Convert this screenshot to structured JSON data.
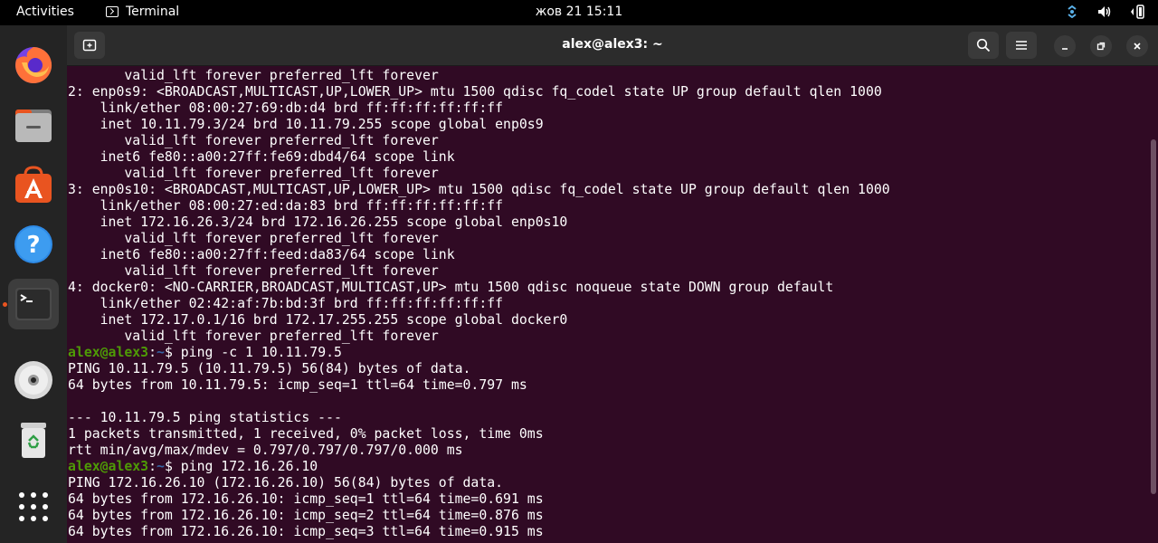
{
  "topbar": {
    "activities": "Activities",
    "app_name": "Terminal",
    "clock": "жов 21  15:11"
  },
  "window": {
    "title": "alex@alex3: ~"
  },
  "dock": {
    "items": [
      "firefox-icon",
      "files-icon",
      "software-icon",
      "help-icon",
      "terminal-icon",
      "dvd-icon",
      "trash-icon",
      "apps-grid-icon"
    ]
  },
  "terminal": {
    "lines": [
      {
        "type": "out",
        "text": "       valid_lft forever preferred_lft forever"
      },
      {
        "type": "out",
        "text": "2: enp0s9: <BROADCAST,MULTICAST,UP,LOWER_UP> mtu 1500 qdisc fq_codel state UP group default qlen 1000"
      },
      {
        "type": "out",
        "text": "    link/ether 08:00:27:69:db:d4 brd ff:ff:ff:ff:ff:ff"
      },
      {
        "type": "out",
        "text": "    inet 10.11.79.3/24 brd 10.11.79.255 scope global enp0s9"
      },
      {
        "type": "out",
        "text": "       valid_lft forever preferred_lft forever"
      },
      {
        "type": "out",
        "text": "    inet6 fe80::a00:27ff:fe69:dbd4/64 scope link"
      },
      {
        "type": "out",
        "text": "       valid_lft forever preferred_lft forever"
      },
      {
        "type": "out",
        "text": "3: enp0s10: <BROADCAST,MULTICAST,UP,LOWER_UP> mtu 1500 qdisc fq_codel state UP group default qlen 1000"
      },
      {
        "type": "out",
        "text": "    link/ether 08:00:27:ed:da:83 brd ff:ff:ff:ff:ff:ff"
      },
      {
        "type": "out",
        "text": "    inet 172.16.26.3/24 brd 172.16.26.255 scope global enp0s10"
      },
      {
        "type": "out",
        "text": "       valid_lft forever preferred_lft forever"
      },
      {
        "type": "out",
        "text": "    inet6 fe80::a00:27ff:feed:da83/64 scope link"
      },
      {
        "type": "out",
        "text": "       valid_lft forever preferred_lft forever"
      },
      {
        "type": "out",
        "text": "4: docker0: <NO-CARRIER,BROADCAST,MULTICAST,UP> mtu 1500 qdisc noqueue state DOWN group default"
      },
      {
        "type": "out",
        "text": "    link/ether 02:42:af:7b:bd:3f brd ff:ff:ff:ff:ff:ff"
      },
      {
        "type": "out",
        "text": "    inet 172.17.0.1/16 brd 172.17.255.255 scope global docker0"
      },
      {
        "type": "out",
        "text": "       valid_lft forever preferred_lft forever"
      },
      {
        "type": "cmd",
        "user": "alex@alex3",
        "path": "~",
        "text": "$ ping -c 1 10.11.79.5"
      },
      {
        "type": "out",
        "text": "PING 10.11.79.5 (10.11.79.5) 56(84) bytes of data."
      },
      {
        "type": "out",
        "text": "64 bytes from 10.11.79.5: icmp_seq=1 ttl=64 time=0.797 ms"
      },
      {
        "type": "out",
        "text": ""
      },
      {
        "type": "out",
        "text": "--- 10.11.79.5 ping statistics ---"
      },
      {
        "type": "out",
        "text": "1 packets transmitted, 1 received, 0% packet loss, time 0ms"
      },
      {
        "type": "out",
        "text": "rtt min/avg/max/mdev = 0.797/0.797/0.797/0.000 ms"
      },
      {
        "type": "cmd",
        "user": "alex@alex3",
        "path": "~",
        "text": "$ ping 172.16.26.10"
      },
      {
        "type": "out",
        "text": "PING 172.16.26.10 (172.16.26.10) 56(84) bytes of data."
      },
      {
        "type": "out",
        "text": "64 bytes from 172.16.26.10: icmp_seq=1 ttl=64 time=0.691 ms"
      },
      {
        "type": "out",
        "text": "64 bytes from 172.16.26.10: icmp_seq=2 ttl=64 time=0.876 ms"
      },
      {
        "type": "out",
        "text": "64 bytes from 172.16.26.10: icmp_seq=3 ttl=64 time=0.915 ms"
      }
    ]
  },
  "colors": {
    "terminal_bg": "#300a24",
    "prompt_user": "#4e9a06",
    "prompt_path": "#3465a4",
    "accent": "#e95420"
  }
}
